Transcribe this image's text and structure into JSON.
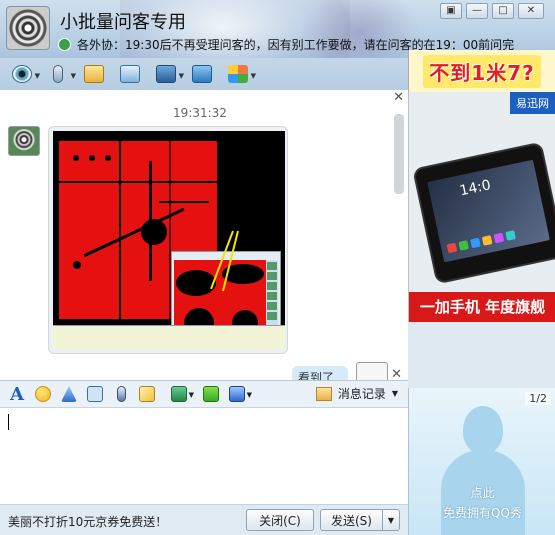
{
  "window": {
    "group_name": "小批量问客专用",
    "notice": "各外协：19:30后不再受理问客的，因有别工作要做，请在问客的在19：00前问完",
    "controls": [
      "▣",
      "—",
      "□",
      "✕"
    ]
  },
  "toolbar": {
    "items": [
      "video-call",
      "voice-call",
      "share-files",
      "add-member",
      "screen-share",
      "remote-assist",
      "apps"
    ]
  },
  "chat": {
    "timestamp": "19:31:32",
    "my_message": "看到了"
  },
  "ad": {
    "top_banner": "不到1米7?",
    "brand": "易迅网",
    "phone_clock": "14:0",
    "slogan": "一加手机 年度旗舰"
  },
  "show_panel": {
    "page": "1/2",
    "line1": "点此",
    "line2": "免费拥有QQ秀"
  },
  "input_bar": {
    "font_label": "A",
    "history_label": "消息记录"
  },
  "bottom": {
    "promo": "美丽不打折10元京券免费送！",
    "close_label": "关闭(C)",
    "send_label": "发送(S)"
  },
  "colors": {
    "accent": "#1d5fbf",
    "pcb_red": "#e51010",
    "ad_red": "#d91818"
  }
}
